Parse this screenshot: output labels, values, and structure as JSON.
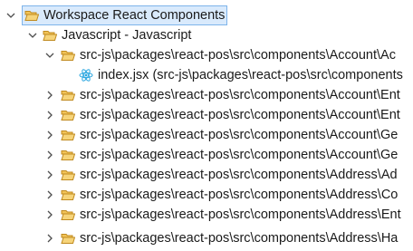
{
  "tree": {
    "root": {
      "label": "Workspace React Components",
      "expanded": true,
      "selected": true,
      "icon": "folder-open-icon"
    },
    "group": {
      "label": "Javascript - Javascript",
      "expanded": true,
      "icon": "folder-open-icon"
    },
    "folders": [
      {
        "label": "src-js\\packages\\react-pos\\src\\components\\Account\\Ac",
        "expanded": true,
        "icon": "folder-open-icon",
        "children": [
          {
            "label": "index.jsx (src-js\\packages\\react-pos\\src\\components",
            "icon": "react-icon"
          }
        ]
      },
      {
        "label": "src-js\\packages\\react-pos\\src\\components\\Account\\Ent",
        "expanded": false,
        "icon": "folder-open-icon"
      },
      {
        "label": "src-js\\packages\\react-pos\\src\\components\\Account\\Ent",
        "expanded": false,
        "icon": "folder-open-icon"
      },
      {
        "label": "src-js\\packages\\react-pos\\src\\components\\Account\\Ge",
        "expanded": false,
        "icon": "folder-open-icon"
      },
      {
        "label": "src-js\\packages\\react-pos\\src\\components\\Account\\Ge",
        "expanded": false,
        "icon": "folder-open-icon"
      },
      {
        "label": "src-js\\packages\\react-pos\\src\\components\\Address\\Ad",
        "expanded": false,
        "icon": "folder-open-icon"
      },
      {
        "label": "src-js\\packages\\react-pos\\src\\components\\Address\\Co",
        "expanded": false,
        "icon": "folder-open-icon"
      },
      {
        "label": "src-js\\packages\\react-pos\\src\\components\\Address\\Ent",
        "expanded": false,
        "icon": "folder-open-icon"
      },
      {
        "label": "src-js\\packages\\react-pos\\src\\components\\Address\\Ha",
        "expanded": false,
        "icon": "folder-open-icon"
      }
    ]
  },
  "colors": {
    "selection_bg": "#d9eafc",
    "selection_border": "#7eb4ea",
    "folder_fill": "#f1c358",
    "folder_stroke": "#c08a1e",
    "react_blue": "#29a6e0",
    "twisty": "#4d4d4d"
  }
}
